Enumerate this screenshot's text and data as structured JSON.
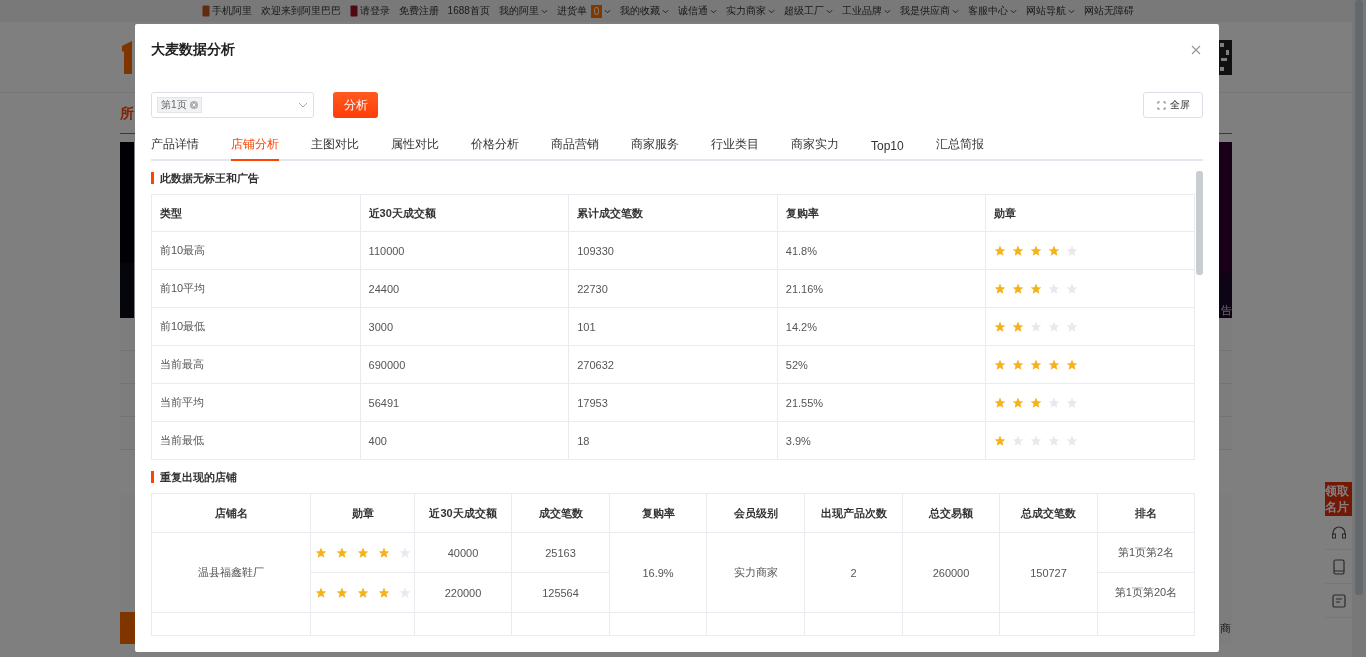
{
  "top_bar": [
    {
      "label": "手机阿里",
      "kind": "phone"
    },
    {
      "label": "欢迎来到阿里巴巴",
      "kind": "plain"
    },
    {
      "label": "请登录",
      "kind": "login"
    },
    {
      "label": "免费注册",
      "kind": "plain"
    },
    {
      "label": "1688首页",
      "kind": "plain"
    },
    {
      "label": "我的阿里",
      "kind": "menu"
    },
    {
      "label": "进货单",
      "kind": "menu",
      "badge": "0"
    },
    {
      "label": "我的收藏",
      "kind": "menu"
    },
    {
      "label": "诚信通",
      "kind": "menu"
    },
    {
      "label": "实力商家",
      "kind": "menu"
    },
    {
      "label": "超级工厂",
      "kind": "menu"
    },
    {
      "label": "工业品牌",
      "kind": "menu"
    },
    {
      "label": "我是供应商",
      "kind": "menu"
    },
    {
      "label": "客服中心",
      "kind": "menu"
    },
    {
      "label": "网站导航",
      "kind": "menu"
    },
    {
      "label": "网站无障碍",
      "kind": "plain"
    }
  ],
  "page_behind": {
    "nav_fragment": "所",
    "ad_label_fragment": "告",
    "footer_fragment": "商",
    "side_promo": "领取名片"
  },
  "dialog": {
    "title": "大麦数据分析",
    "page_select": {
      "tags": [
        "第1页"
      ]
    },
    "analyze_button": "分析",
    "fullscreen_button": "全屏",
    "tabs": [
      {
        "label": "产品详情",
        "selected": false
      },
      {
        "label": "店铺分析",
        "selected": true
      },
      {
        "label": "主图对比",
        "selected": false
      },
      {
        "label": "属性对比",
        "selected": false
      },
      {
        "label": "价格分析",
        "selected": false
      },
      {
        "label": "商品营销",
        "selected": false
      },
      {
        "label": "商家服务",
        "selected": false
      },
      {
        "label": "行业类目",
        "selected": false
      },
      {
        "label": "商家实力",
        "selected": false
      },
      {
        "label": "Top10",
        "selected": false
      },
      {
        "label": "汇总简报",
        "selected": false
      }
    ],
    "summary": {
      "title": "此数据无标王和广告",
      "columns": [
        "类型",
        "近30天成交额",
        "累计成交笔数",
        "复购率",
        "勋章"
      ],
      "rows": [
        {
          "type": "前10最高",
          "amount": "110000",
          "count": "109330",
          "rate": "41.8%",
          "stars": 4
        },
        {
          "type": "前10平均",
          "amount": "24400",
          "count": "22730",
          "rate": "21.16%",
          "stars": 3
        },
        {
          "type": "前10最低",
          "amount": "3000",
          "count": "101",
          "rate": "14.2%",
          "stars": 2
        },
        {
          "type": "当前最高",
          "amount": "690000",
          "count": "270632",
          "rate": "52%",
          "stars": 5
        },
        {
          "type": "当前平均",
          "amount": "56491",
          "count": "17953",
          "rate": "21.55%",
          "stars": 3
        },
        {
          "type": "当前最低",
          "amount": "400",
          "count": "18",
          "rate": "3.9%",
          "stars": 1
        }
      ]
    },
    "repeat_shops": {
      "title": "重复出现的店铺",
      "columns": [
        "店铺名",
        "勋章",
        "近30天成交额",
        "成交笔数",
        "复购率",
        "会员级别",
        "出现产品次数",
        "总交易额",
        "总成交笔数",
        "排名"
      ],
      "shops": [
        {
          "name": "温县福鑫鞋厂",
          "repurchase": "16.9%",
          "level": "实力商家",
          "appearances": "2",
          "total_amount": "260000",
          "total_count": "150727",
          "entries": [
            {
              "stars": 4,
              "amount": "40000",
              "count": "25163",
              "rank": "第1页第2名"
            },
            {
              "stars": 4,
              "amount": "220000",
              "count": "125564",
              "rank": "第1页第20名"
            }
          ]
        }
      ]
    }
  }
}
